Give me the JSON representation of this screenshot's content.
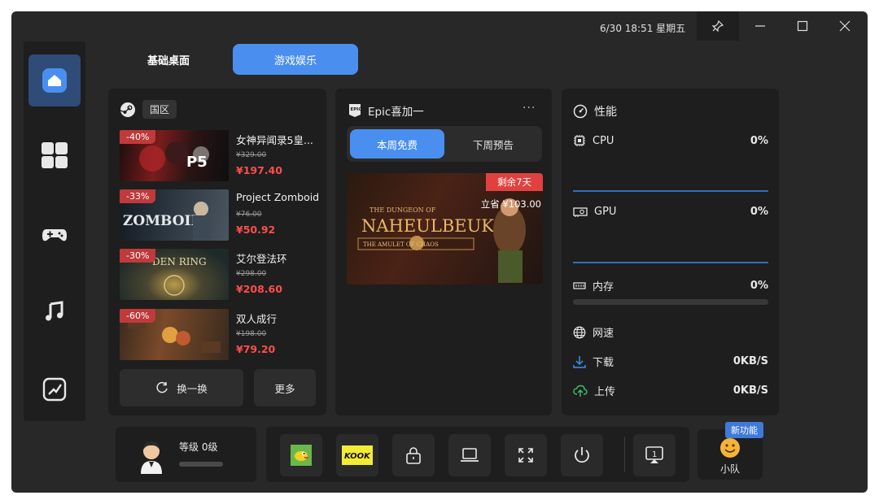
{
  "titlebar": {
    "datetime": "6/30 18:51 星期五"
  },
  "tabs": [
    {
      "label": "基础桌面"
    },
    {
      "label": "游戏娱乐"
    }
  ],
  "steam": {
    "region": "国区",
    "games": [
      {
        "discount": "-40%",
        "title": "女神异闻录5皇...",
        "original_price": "¥329.00",
        "price": "¥197.40"
      },
      {
        "discount": "-33%",
        "title": "Project Zomboid",
        "original_price": "¥76.00",
        "price": "¥50.92"
      },
      {
        "discount": "-30%",
        "title": "艾尔登法环",
        "original_price": "¥298.00",
        "price": "¥208.60"
      },
      {
        "discount": "-60%",
        "title": "双人成行",
        "original_price": "¥198.00",
        "price": "¥79.20"
      }
    ],
    "refresh_label": "换一换",
    "more_label": "更多"
  },
  "epic": {
    "title": "Epic喜加一",
    "more": "···",
    "tabs": [
      {
        "label": "本周免费"
      },
      {
        "label": "下周预告"
      }
    ],
    "banner": {
      "remaining": "剩余7天",
      "save": "立省 ¥103.00",
      "game_title_line1": "THE DUNGEON OF",
      "game_title_line2": "NAHEULBEUK",
      "game_title_line3": "THE AMULET OF CHAOS"
    }
  },
  "performance": {
    "title": "性能",
    "cpu": {
      "label": "CPU",
      "value": "0%"
    },
    "gpu": {
      "label": "GPU",
      "value": "0%"
    },
    "memory": {
      "label": "内存",
      "value": "0%"
    },
    "network": {
      "label": "网速"
    },
    "download": {
      "label": "下载",
      "value": "0KB/S"
    },
    "upload": {
      "label": "上传",
      "value": "0KB/S"
    }
  },
  "user": {
    "level": "等级 0级"
  },
  "tools": [
    {
      "icon": "flappy-bird-icon"
    },
    {
      "icon": "kook-icon"
    },
    {
      "icon": "lock-icon"
    },
    {
      "icon": "laptop-icon"
    },
    {
      "icon": "fullscreen-icon"
    },
    {
      "icon": "power-icon"
    },
    {
      "icon": "screen-cast-icon"
    }
  ],
  "team": {
    "label": "小队",
    "badge": "新功能"
  },
  "colors": {
    "accent": "#4a8ff0",
    "discount": "#c0393b",
    "price": "#ff4d4d",
    "background": "#282828",
    "card": "#1e1e1e"
  }
}
